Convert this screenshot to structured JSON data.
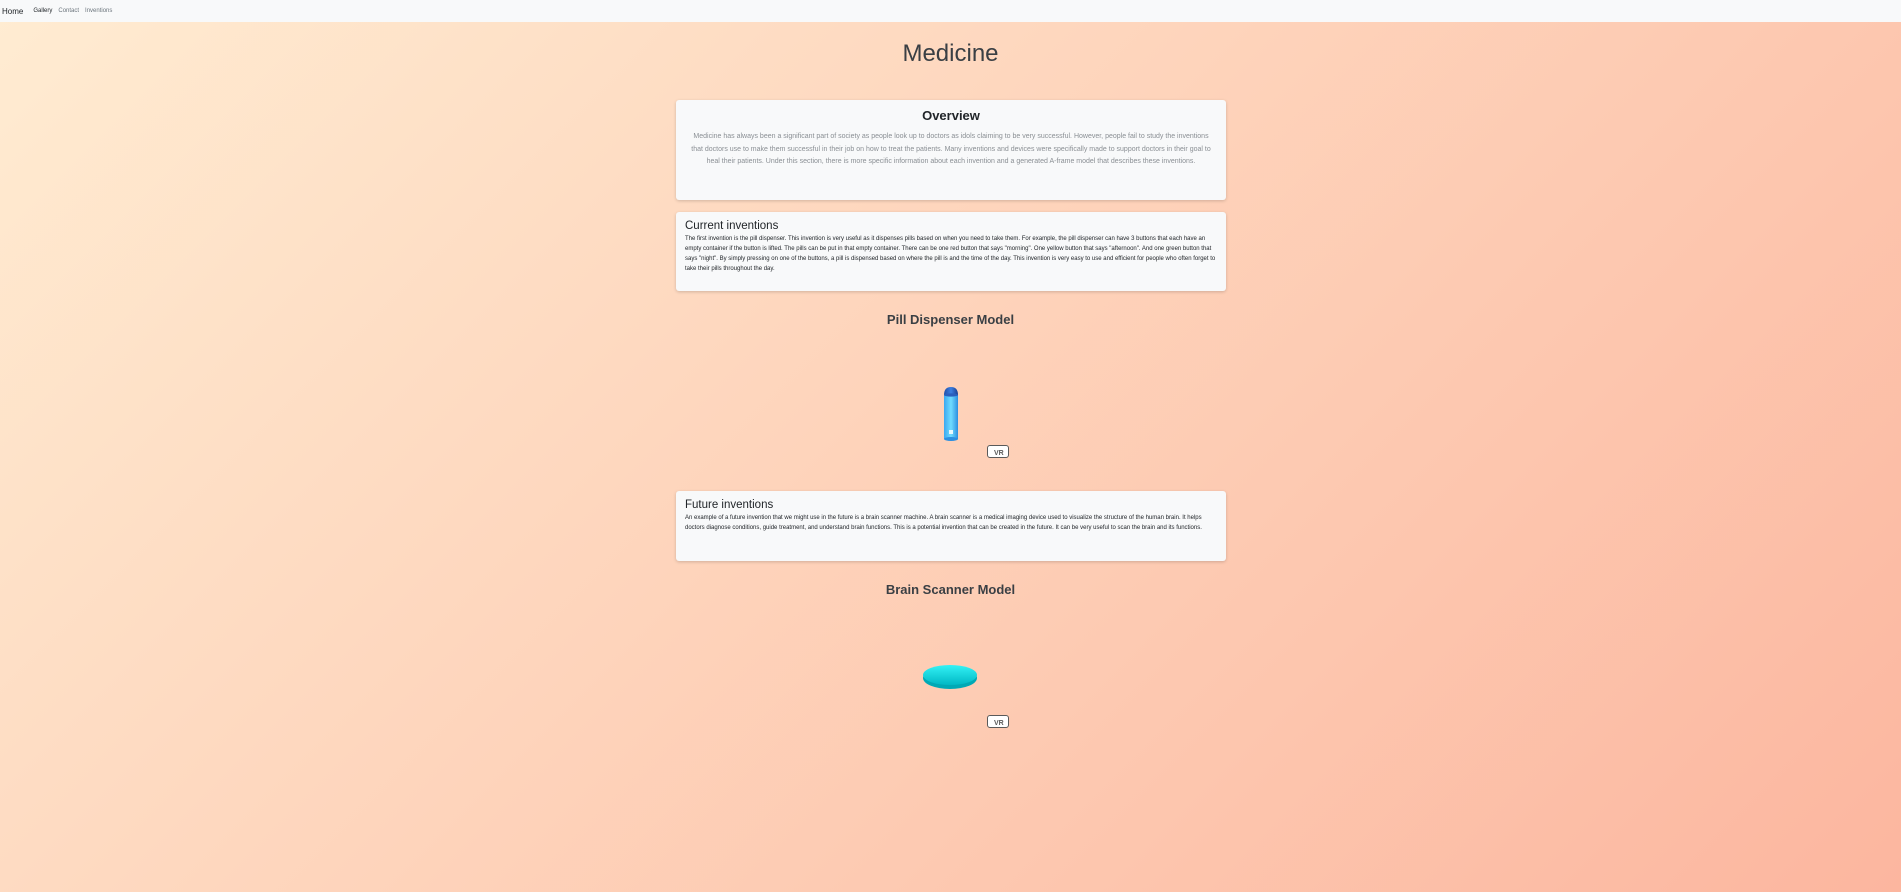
{
  "nav": {
    "brand": "Home",
    "links": [
      "Gallery",
      "Contact",
      "Inventions"
    ]
  },
  "page": {
    "title": "Medicine"
  },
  "overview": {
    "heading": "Overview",
    "text": "Medicine has always been a significant part of society as people look up to doctors as idols claiming to be very successful. However, people fail to study the inventions that doctors use to make them successful in their job on how to treat the patients. Many inventions and devices were specifically made to support doctors in their goal to heal their patients. Under this section, there is more specific information about each invention and a generated A-frame model that describes these inventions."
  },
  "current": {
    "heading": "Current inventions",
    "text": "The first invention is the pill dispenser. This invention is very useful as it dispenses pills based on when you need to take them. For example, the pill dispenser can have 3 buttons that each have an empty container if the button is lifted. The pills can be put in that empty container. There can be one red button that says \"morning\". One yellow button that says \"afternoon\". And one green button that says \"night\". By simply pressing on one of the buttons, a pill is dispensed based on where the pill is and the time of the day. This invention is very easy to use and efficient for people who often forget to take their pills throughout the day."
  },
  "pill_model": {
    "title": "Pill Dispenser Model",
    "vr_label": "VR"
  },
  "future": {
    "heading": "Future inventions",
    "text": "An example of a future invention that we might use in the future is a brain scanner machine. A brain scanner is a medical imaging device used to visualize the structure of the human brain. It helps doctors diagnose conditions, guide treatment, and understand brain functions. This is a potential invention that can be created in the future. It can be very useful to scan the brain and its functions."
  },
  "brain_model": {
    "title": "Brain Scanner Model",
    "vr_label": "VR"
  },
  "colors": {
    "gradient_start": "#ffecd2",
    "gradient_end": "#fcb69f",
    "pill_cylinder": "#5fd0ff",
    "pill_cap": "#2a6fd1",
    "brain_disc": "#00e5ea"
  }
}
